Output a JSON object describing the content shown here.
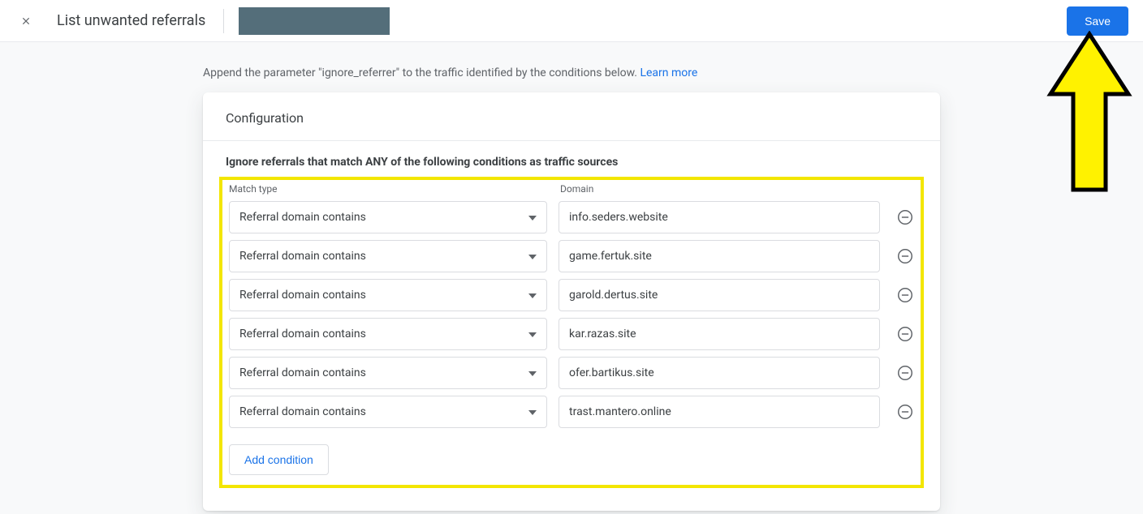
{
  "header": {
    "title": "List unwanted referrals",
    "save_label": "Save"
  },
  "intro": {
    "text": "Append the parameter \"ignore_referrer\" to the traffic identified by the conditions below. ",
    "learn_more": "Learn more"
  },
  "card": {
    "heading": "Configuration",
    "section_label": "Ignore referrals that match ANY of the following conditions as traffic sources",
    "col_match": "Match type",
    "col_domain": "Domain",
    "match_option": "Referral domain contains",
    "rows": [
      {
        "domain": "info.seders.website"
      },
      {
        "domain": "game.fertuk.site"
      },
      {
        "domain": "garold.dertus.site"
      },
      {
        "domain": "kar.razas.site"
      },
      {
        "domain": "ofer.bartikus.site"
      },
      {
        "domain": "trast.mantero.online"
      }
    ],
    "add_label": "Add condition"
  }
}
